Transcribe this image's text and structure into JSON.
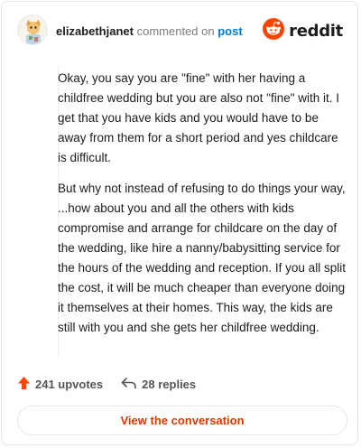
{
  "header": {
    "username": "elizabethjanet",
    "action_text": "commented on",
    "post_link": "post",
    "brand": "reddit"
  },
  "comment": {
    "paragraphs": [
      "Okay, you say you are \"fine\" with her having a childfree wedding but you are also not \"fine\" with it. I get that you have kids and you would have to be away from them for a short period and yes childcare is difficult.",
      "But why not instead of refusing to do things your way, ...how about you and all the others with kids compromise and arrange for childcare on the day of the wedding, like hire a nanny/babysitting service for the hours of the wedding and reception. If you all split the cost, it will be much cheaper than everyone doing it themselves at their homes. This way, the kids are still with you and she gets her childfree wedding."
    ]
  },
  "stats": {
    "upvotes": "241 upvotes",
    "replies": "28 replies"
  },
  "cta": {
    "label": "View the conversation"
  },
  "colors": {
    "brand": "#ff4500",
    "cta_text": "#d93a00",
    "link": "#0079d3"
  },
  "icons": {
    "avatar": "avatar",
    "brand_logo": "reddit-snoo-icon",
    "upvote": "upvote-arrow-icon",
    "reply": "reply-arrow-icon"
  }
}
